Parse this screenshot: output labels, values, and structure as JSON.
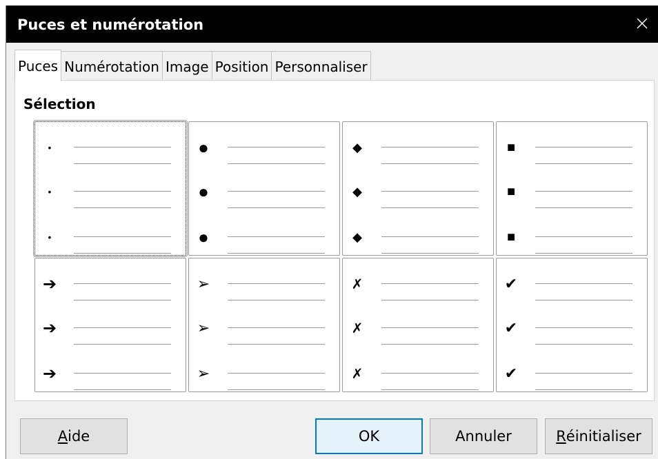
{
  "window": {
    "title": "Puces et numérotation"
  },
  "tabs": [
    {
      "label": "Puces",
      "active": true
    },
    {
      "label": "Numérotation",
      "active": false
    },
    {
      "label": "Image",
      "active": false
    },
    {
      "label": "Position",
      "active": false
    },
    {
      "label": "Personnaliser",
      "active": false
    }
  ],
  "selection": {
    "label": "Sélection"
  },
  "bullet_styles": [
    {
      "name": "small-dot",
      "glyph": "•"
    },
    {
      "name": "large-dot",
      "glyph": "●"
    },
    {
      "name": "diamond",
      "glyph": "◆"
    },
    {
      "name": "square",
      "glyph": "■"
    },
    {
      "name": "bold-arrow",
      "glyph": "➔"
    },
    {
      "name": "arrowhead",
      "glyph": "➢"
    },
    {
      "name": "cross-mark",
      "glyph": "✗"
    },
    {
      "name": "check-mark",
      "glyph": "✔"
    }
  ],
  "buttons": {
    "help": {
      "prefix": "",
      "accel": "A",
      "rest": "ide"
    },
    "ok": {
      "label": "OK"
    },
    "cancel": {
      "label": "Annuler"
    },
    "reset": {
      "prefix": "",
      "accel": "R",
      "rest": "éinitialiser"
    }
  },
  "colors": {
    "titlebar": "#000000",
    "accent": "#0078d7",
    "dialog_bg": "#f0f0f0"
  }
}
